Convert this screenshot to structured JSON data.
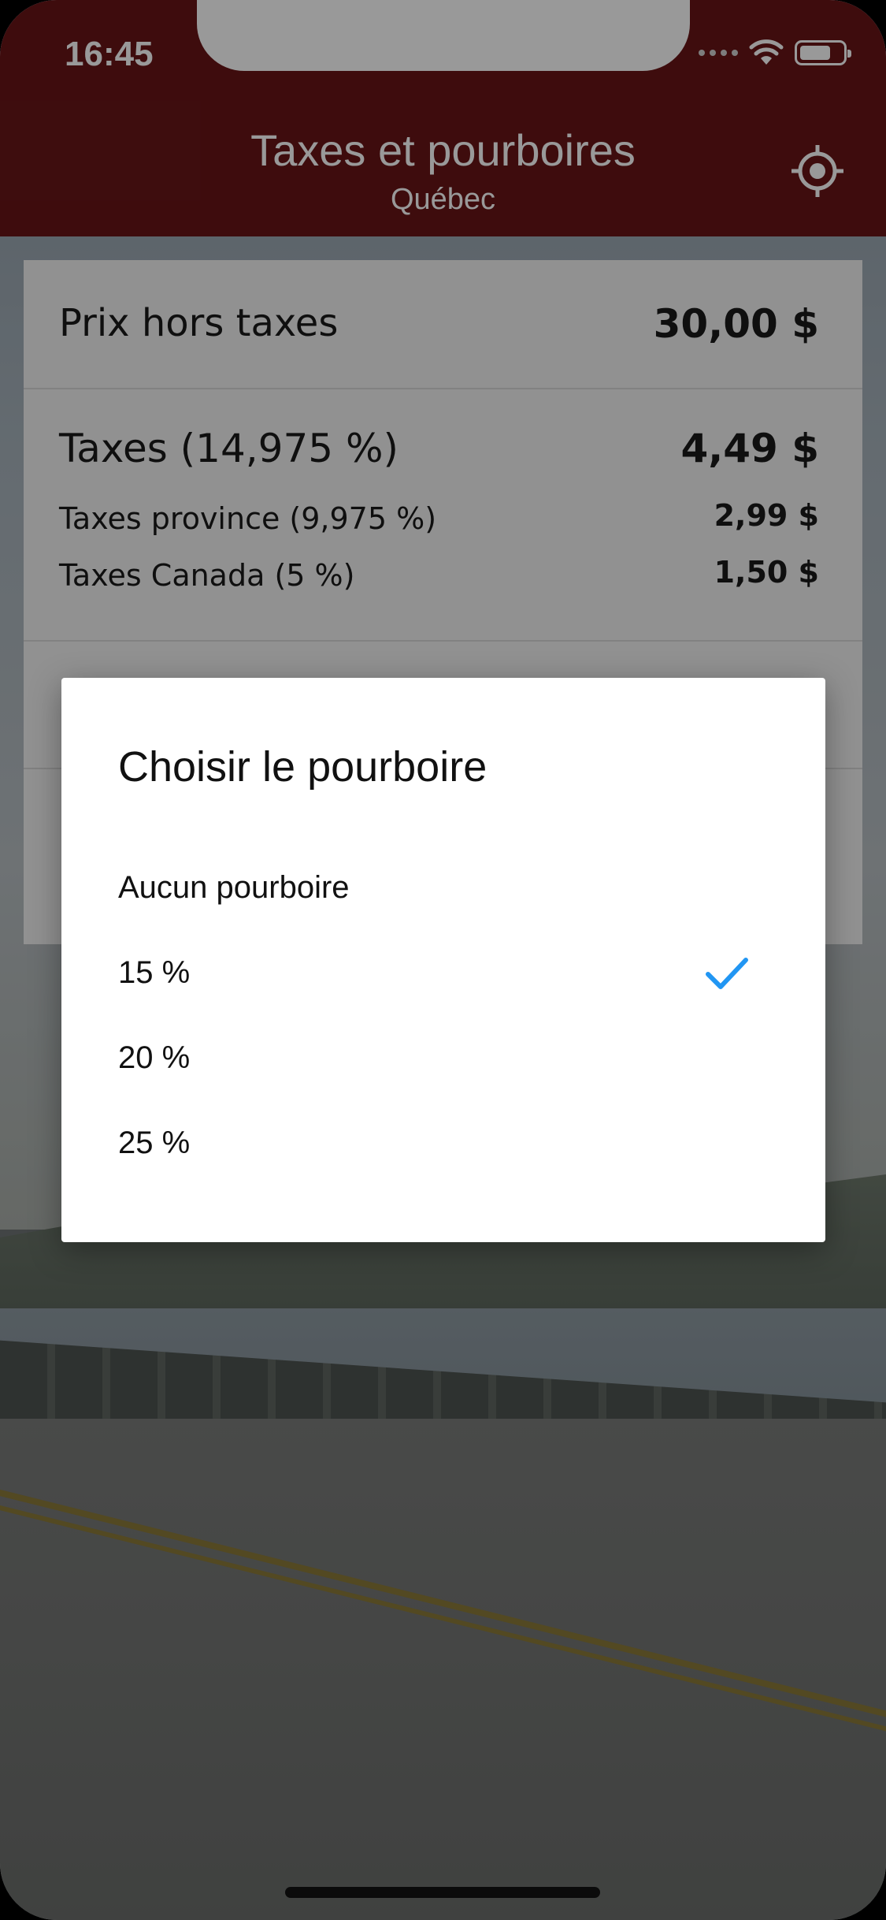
{
  "status_bar": {
    "time": "16:45"
  },
  "header": {
    "title": "Taxes et pourboires",
    "subtitle": "Québec",
    "background": "#681517"
  },
  "card": {
    "price_label": "Prix hors taxes",
    "price_value": "30,00 $",
    "taxes_label": "Taxes (14,975 %)",
    "taxes_value": "4,49 $",
    "province_label": "Taxes province (9,975 %)",
    "province_value": "2,99 $",
    "canada_label": "Taxes Canada (5 %)",
    "canada_value": "1,50 $"
  },
  "dialog": {
    "title": "Choisir le pourboire",
    "options": [
      {
        "label": "Aucun pourboire",
        "selected": false
      },
      {
        "label": "15 %",
        "selected": true
      },
      {
        "label": "20 %",
        "selected": false
      },
      {
        "label": "25 %",
        "selected": false
      }
    ],
    "check_color": "#2196F3"
  }
}
